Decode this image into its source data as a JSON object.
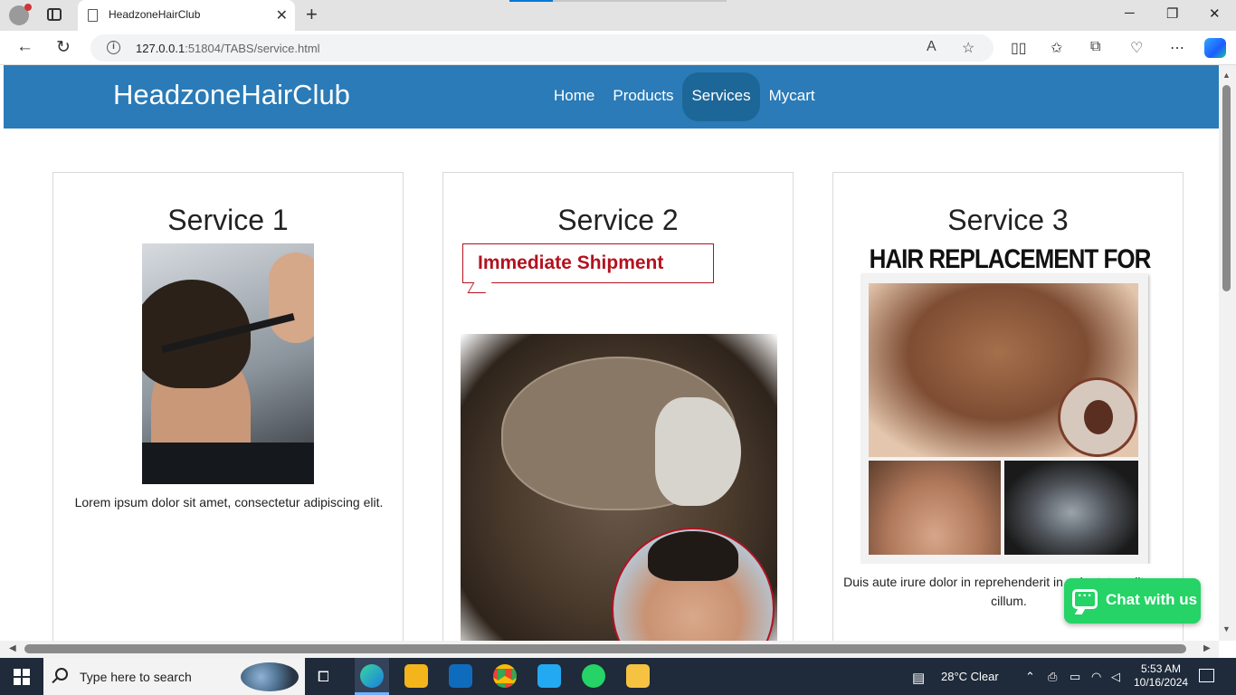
{
  "browser": {
    "tab_title": "HeadzoneHairClub",
    "url_host": "127.0.0.1",
    "url_rest": ":51804/TABS/service.html"
  },
  "site": {
    "brand": "HeadzoneHairClub",
    "nav": [
      "Home",
      "Products",
      "Services",
      "Mycart"
    ],
    "active_nav": "Services"
  },
  "services": [
    {
      "title": "Service 1",
      "text": "Lorem ipsum dolor sit amet, consectetur adipiscing elit."
    },
    {
      "title": "Service 2",
      "image_banner": "Immediate Shipment"
    },
    {
      "title": "Service 3",
      "image_title": "HAIR REPLACEMENT FOR MEN",
      "text": "Duis aute irure dolor in reprehenderit in voluptate velit esse cillum."
    }
  ],
  "chat_button": "Chat with us",
  "taskbar": {
    "search_placeholder": "Type here to search",
    "weather": "28°C  Clear",
    "time": "5:53 AM",
    "date": "10/16/2024"
  },
  "colors": {
    "header_bg": "#2a7bb7",
    "nav_active_bg": "#1d6798",
    "chat_bg": "#25d366",
    "banner_red": "#b3121f"
  }
}
